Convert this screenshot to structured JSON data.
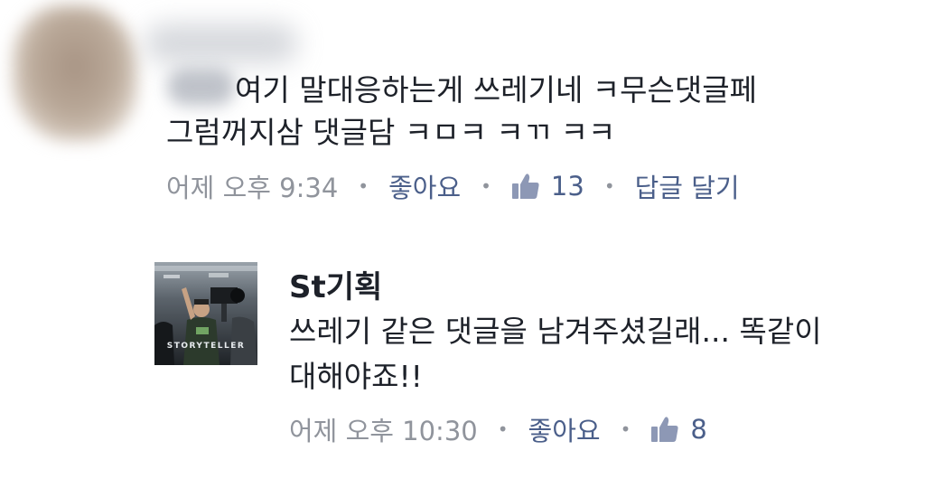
{
  "comment1": {
    "text_line1": "여기 말대응하는게 쓰레기네 ㅋ무슨댓글페",
    "text_line2": "그럼꺼지삼 댓글담 ㅋㅁㅋ ㅋㄲ ㅋㅋ",
    "time": "어제 오후 9:34",
    "like_label": "좋아요",
    "like_count": "13",
    "reply_label": "답글 달기",
    "separator": "•"
  },
  "comment2": {
    "author": "St기획",
    "avatar_caption": "STORYTELLER",
    "text_line1": "쓰레기 같은 댓글을 남겨주셨길래... 똑같이",
    "text_line2": "대해야죠!!",
    "time": "어제 오후 10:30",
    "like_label": "좋아요",
    "like_count": "8",
    "separator": "•"
  },
  "colors": {
    "text": "#1d2129",
    "meta_gray": "#90949c",
    "link_blue": "#4b5f8a",
    "thumb_icon": "#8d98b5"
  },
  "icons": [
    "thumbs-up-icon"
  ]
}
